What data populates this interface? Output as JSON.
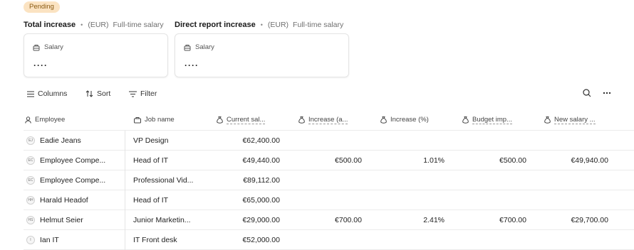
{
  "status": "Pending",
  "summaries": [
    {
      "title": "Total increase",
      "currency": "(EUR)",
      "type": "Full-time salary",
      "card_label": "Salary",
      "card_value": "····"
    },
    {
      "title": "Direct report increase",
      "currency": "(EUR)",
      "type": "Full-time salary",
      "card_label": "Salary",
      "card_value": "····"
    }
  ],
  "toolbar": {
    "columns": "Columns",
    "sort": "Sort",
    "filter": "Filter"
  },
  "table": {
    "headers": [
      "Employee",
      "Job name",
      "Current sal...",
      "Increase (a...",
      "Increase (%)",
      "Budget imp...",
      "New salary ..."
    ],
    "rows": [
      {
        "initials": "EJ",
        "employee": "Eadie Jeans",
        "job": "VP Design",
        "current": "€62,400.00",
        "inc_amount": "",
        "inc_pct": "",
        "budget": "",
        "new_salary": ""
      },
      {
        "initials": "EC",
        "employee": "Employee Compe...",
        "job": "Head of IT",
        "current": "€49,440.00",
        "inc_amount": "€500.00",
        "inc_pct": "1.01%",
        "budget": "€500.00",
        "new_salary": "€49,940.00"
      },
      {
        "initials": "EC",
        "employee": "Employee Compe...",
        "job": "Professional Vid...",
        "current": "€89,112.00",
        "inc_amount": "",
        "inc_pct": "",
        "budget": "",
        "new_salary": ""
      },
      {
        "initials": "HH",
        "employee": "Harald Headof",
        "job": "Head of IT",
        "current": "€65,000.00",
        "inc_amount": "",
        "inc_pct": "",
        "budget": "",
        "new_salary": ""
      },
      {
        "initials": "HS",
        "employee": "Helmut Seier",
        "job": "Junior Marketin...",
        "current": "€29,000.00",
        "inc_amount": "€700.00",
        "inc_pct": "2.41%",
        "budget": "€700.00",
        "new_salary": "€29,700.00"
      },
      {
        "initials": "I",
        "employee": "Ian IT",
        "job": "IT Front desk",
        "current": "€52,000.00",
        "inc_amount": "",
        "inc_pct": "",
        "budget": "",
        "new_salary": ""
      }
    ]
  }
}
